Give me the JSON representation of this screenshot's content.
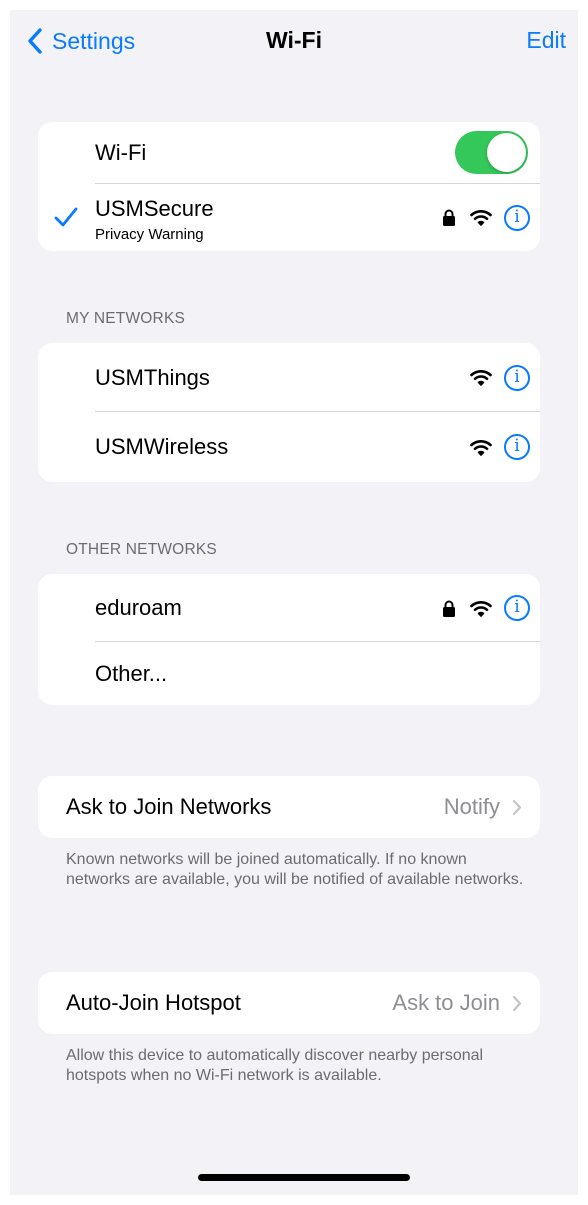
{
  "nav": {
    "back_label": "Settings",
    "title": "Wi-Fi",
    "edit_label": "Edit"
  },
  "wifi_toggle": {
    "label": "Wi-Fi",
    "state": "on",
    "color": "#34c759"
  },
  "connected": {
    "ssid": "USMSecure",
    "subtitle": "Privacy Warning",
    "locked": true,
    "icons": [
      "checkmark-icon",
      "lock-icon",
      "wifi-signal-icon",
      "info-icon"
    ]
  },
  "my_networks": {
    "header": "MY NETWORKS",
    "items": [
      {
        "name": "USMThings",
        "locked": false
      },
      {
        "name": "USMWireless",
        "locked": false
      }
    ]
  },
  "other_networks": {
    "header": "OTHER NETWORKS",
    "items": [
      {
        "name": "eduroam",
        "locked": true
      }
    ],
    "other_label": "Other..."
  },
  "ask_to_join": {
    "label": "Ask to Join Networks",
    "value": "Notify",
    "footnote": "Known networks will be joined automatically. If no known networks are available, you will be notified of available networks."
  },
  "auto_join": {
    "label": "Auto-Join Hotspot",
    "value": "Ask to Join",
    "footnote": "Allow this device to automatically discover nearby personal hotspots when no Wi-Fi network is available."
  },
  "colors": {
    "accent": "#0a7aff",
    "background": "#f2f2f7",
    "toggle_on": "#34c759",
    "secondary_text": "#8e8e93"
  }
}
